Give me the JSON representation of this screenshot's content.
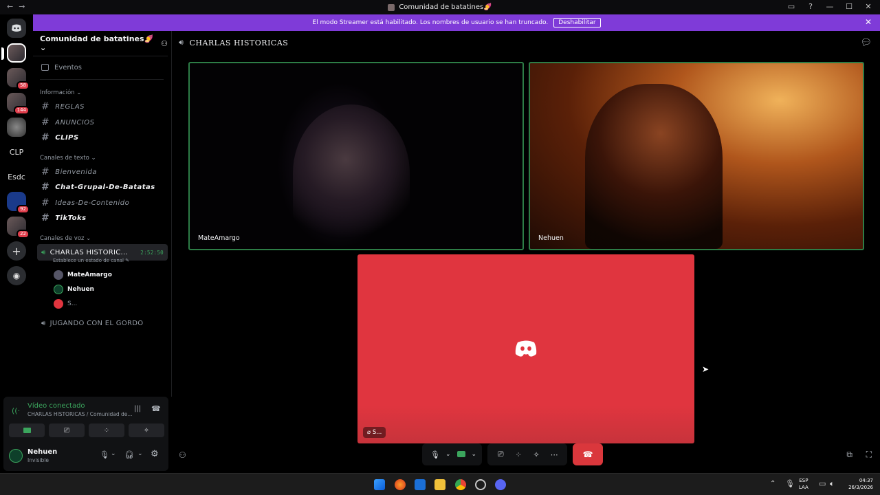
{
  "window": {
    "title": "Comunidad de batatines🍠",
    "controls": [
      "▭",
      "?",
      "—",
      "☐",
      "✕"
    ]
  },
  "banner": {
    "text": "El modo Streamer está habilitado. Los nombres de usuario se han truncado.",
    "button": "Deshabilitar",
    "color": "#7f3bd8"
  },
  "rail": {
    "servers": [
      {
        "label": "",
        "badge": ""
      },
      {
        "label": "",
        "badge": "58"
      },
      {
        "label": "",
        "badge": "144"
      },
      {
        "label": "",
        "badge": ""
      },
      {
        "label": "CLP",
        "badge": ""
      },
      {
        "label": "Esdc",
        "badge": ""
      },
      {
        "label": "",
        "badge": "92"
      },
      {
        "label": "",
        "badge": "22"
      }
    ]
  },
  "sidebar": {
    "server_name": "Comunidad de batatines🍠",
    "events": "Eventos",
    "categories": {
      "info": "Información",
      "text": "Canales de texto",
      "voice": "Canales de voz"
    },
    "info_channels": [
      "REGLAS",
      "ANUNCIOS",
      "CLIPS"
    ],
    "text_channels": [
      "Bienvenida",
      "Chat-Grupal-De-Batatas",
      "Ideas-De-Contenido",
      "TikToks"
    ],
    "voice_active": {
      "name": "CHARLAS HISTORIC...",
      "timer": "2:52:50",
      "status": "Establece un estado de canal"
    },
    "voice_users": [
      "MateAmargo",
      "Nehuen",
      "S..."
    ],
    "voice_other": "JUGANDO CON EL GORDO"
  },
  "voice_panel": {
    "status": "Vídeo conectado",
    "location": "CHARLAS HISTORICAS / Comunidad de..."
  },
  "user_panel": {
    "name": "Nehuen",
    "status": "Invisible"
  },
  "main": {
    "channel": "CHARLAS HISTORICAS",
    "tiles": [
      "MateAmargo",
      "Nehuen"
    ],
    "muted_tag": "S..."
  },
  "taskbar": {
    "lang": "ESP",
    "lang2": "LAA",
    "time": "04:37",
    "date": "26/3/2026"
  },
  "colors": {
    "speaking_border": "#2d7d46",
    "discord_red": "#e0353f",
    "connected_green": "#3ba55d"
  }
}
